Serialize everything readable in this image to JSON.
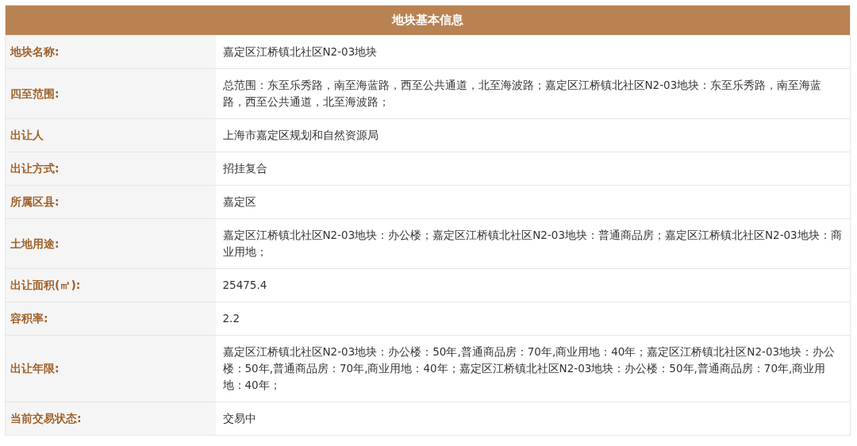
{
  "title": "地块基本信息",
  "rows": [
    {
      "label": "地块名称:",
      "value": "嘉定区江桥镇北社区N2-03地块"
    },
    {
      "label": "四至范围:",
      "value": "总范围：东至乐秀路，南至海蓝路，西至公共通道，北至海波路；嘉定区江桥镇北社区N2-03地块：东至乐秀路，南至海蓝路，西至公共通道，北至海波路；"
    },
    {
      "label": "出让人",
      "value": "上海市嘉定区规划和自然资源局"
    },
    {
      "label": "出让方式:",
      "value": "招挂复合"
    },
    {
      "label": "所属区县:",
      "value": "嘉定区"
    },
    {
      "label": "土地用途:",
      "value": "嘉定区江桥镇北社区N2-03地块：办公楼；嘉定区江桥镇北社区N2-03地块：普通商品房；嘉定区江桥镇北社区N2-03地块：商业用地；"
    },
    {
      "label": "出让面积(㎡):",
      "value": "25475.4"
    },
    {
      "label": "容积率:",
      "value": "2.2"
    },
    {
      "label": "出让年限:",
      "value": "嘉定区江桥镇北社区N2-03地块：办公楼：50年,普通商品房：70年,商业用地：40年；嘉定区江桥镇北社区N2-03地块：办公楼：50年,普通商品房：70年,商业用地：40年；嘉定区江桥镇北社区N2-03地块：办公楼：50年,普通商品房：70年,商业用地：40年；"
    },
    {
      "label": "当前交易状态:",
      "value": "交易中"
    }
  ]
}
